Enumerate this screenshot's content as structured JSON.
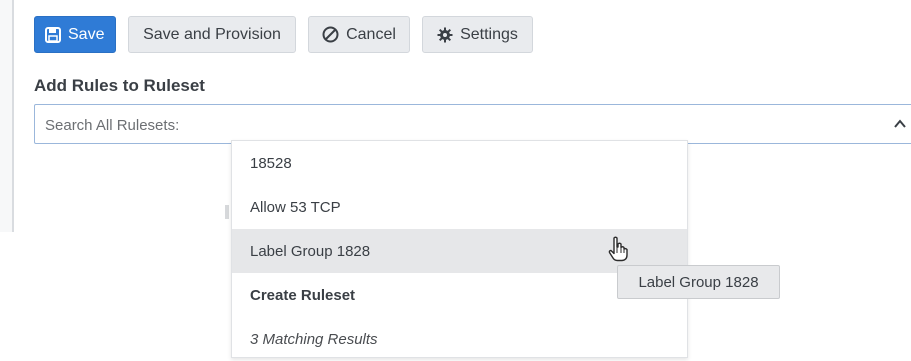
{
  "toolbar": {
    "save_label": "Save",
    "save_provision_label": "Save and Provision",
    "cancel_label": "Cancel",
    "settings_label": "Settings"
  },
  "section": {
    "title": "Add Rules to Ruleset"
  },
  "search": {
    "placeholder": "Search All Rulesets:",
    "value": ""
  },
  "dropdown": {
    "options": [
      "18528",
      "Allow 53 TCP",
      "Label Group 1828"
    ],
    "create_label": "Create Ruleset",
    "results_text": "3 Matching Results",
    "hovered_index": 2
  },
  "tooltip": {
    "text": "Label Group 1828"
  },
  "colors": {
    "primary": "#2f7bd6",
    "hover_bg": "#e6e7e9",
    "focus_border": "#9bb7db"
  },
  "icons": {
    "save": "floppy-disk-icon",
    "cancel": "ban-circle-icon",
    "settings": "gear-icon",
    "chevron": "chevron-up-icon",
    "cursor": "hand-pointer-icon"
  }
}
